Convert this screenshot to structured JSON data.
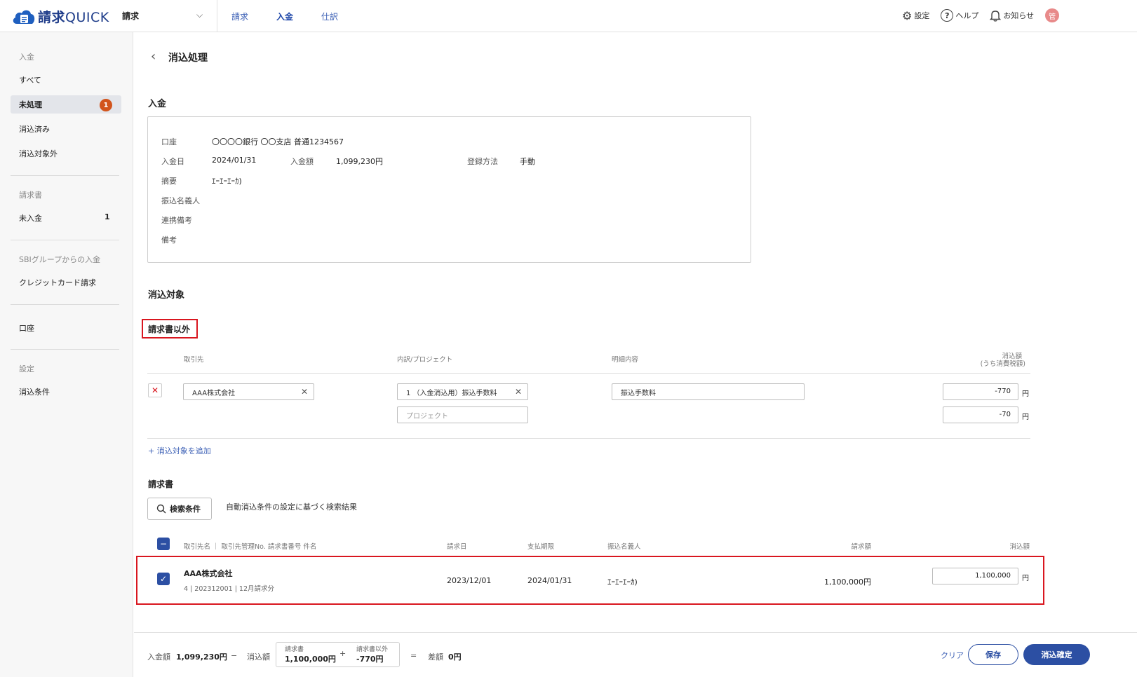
{
  "app": {
    "logo_text_kanji": "請求",
    "logo_text_latin": "QUICK"
  },
  "header": {
    "mode": "請求",
    "nav": [
      "請求",
      "入金",
      "仕訳"
    ],
    "settings": "設定",
    "help": "ヘルプ",
    "notifications": "お知らせ",
    "avatar": "管"
  },
  "sidebar": {
    "deposit_head": "入金",
    "all": "すべて",
    "unprocessed": "未処理",
    "unprocessed_count": "1",
    "reconciled": "消込済み",
    "excluded": "消込対象外",
    "invoice_head": "請求書",
    "unpaid": "未入金",
    "unpaid_count": "1",
    "sbi_head": "SBIグループからの入金",
    "credit": "クレジットカード請求",
    "account": "口座",
    "settings_head": "設定",
    "conditions": "消込条件"
  },
  "page": {
    "title": "消込処理"
  },
  "deposit": {
    "section": "入金",
    "account_label": "口座",
    "account_value": "〇〇〇〇銀行 〇〇支店 普通1234567",
    "date_label": "入金日",
    "date_value": "2024/01/31",
    "amount_label": "入金額",
    "amount_value": "1,099,230円",
    "method_label": "登録方法",
    "method_value": "手動",
    "summary_label": "摘要",
    "summary_value": "ｴｰｴｰｴｰｶ)",
    "payer_label": "振込名義人",
    "linked_label": "連携備考",
    "memo_label": "備考"
  },
  "target": {
    "section": "消込対象",
    "non_invoice": {
      "title": "請求書以外",
      "col_partner": "取引先",
      "col_project": "内訳/プロジェクト",
      "col_detail": "明細内容",
      "col_amount": "消込額",
      "col_amount_sub": "(うち消費税額)",
      "partner_value": "AAA株式会社",
      "breakdown_value": "1 （入金消込用）振込手数料",
      "project_placeholder": "プロジェクト",
      "detail_value": "振込手数料",
      "amount_value": "-770",
      "tax_value": "-70",
      "yen": "円",
      "add_link": "+ 消込対象を追加"
    },
    "invoice": {
      "title": "請求書",
      "search_button": "検索条件",
      "search_desc": "自動消込条件の設定に基づく検索結果",
      "col_names": "取引先名 ｜ 取引先管理No. 請求書番号 件名",
      "col_issue": "請求日",
      "col_due": "支払期限",
      "col_payer": "振込名義人",
      "col_billed": "請求額",
      "col_reconcile": "消込額",
      "row": {
        "partner": "AAA株式会社",
        "sub": "4 | 202312001 | 12月請求分",
        "issue": "2023/12/01",
        "due": "2024/01/31",
        "payer": "ｴｰｴｰｴｰｶ)",
        "billed": "1,100,000円",
        "reconcile": "1,100,000",
        "yen": "円"
      }
    }
  },
  "footer": {
    "deposit_label": "入金額",
    "deposit_value": "1,099,230円",
    "minus": "−",
    "reconcile_label": "消込額",
    "inv_label": "請求書",
    "inv_value": "1,100,000円",
    "plus": "+",
    "other_label": "請求書以外",
    "other_value": "-770円",
    "equals": "=",
    "diff_label": "差額",
    "diff_value": "0円",
    "clear": "クリア",
    "save": "保存",
    "confirm": "消込確定"
  }
}
